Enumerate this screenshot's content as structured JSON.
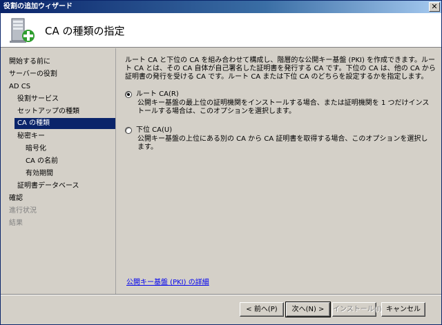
{
  "window": {
    "title": "役割の追加ウィザード",
    "close_glyph": "✕"
  },
  "header": {
    "title": "CA の種類の指定",
    "icon": "server-add-icon"
  },
  "sidebar": {
    "items": [
      {
        "label": "開始する前に",
        "state": "normal"
      },
      {
        "label": "サーバーの役割",
        "state": "normal"
      },
      {
        "label": "AD CS",
        "state": "normal"
      },
      {
        "label": "役割サービス",
        "state": "normal"
      },
      {
        "label": "セットアップの種類",
        "state": "normal"
      },
      {
        "label": "CA の種類",
        "state": "selected"
      },
      {
        "label": "秘密キー",
        "state": "normal"
      },
      {
        "label": "暗号化",
        "state": "normal"
      },
      {
        "label": "CA の名前",
        "state": "normal"
      },
      {
        "label": "有効期間",
        "state": "normal"
      },
      {
        "label": "証明書データベース",
        "state": "normal"
      },
      {
        "label": "確認",
        "state": "normal"
      },
      {
        "label": "進行状況",
        "state": "disabled"
      },
      {
        "label": "結果",
        "state": "disabled"
      }
    ]
  },
  "content": {
    "intro": "ルート CA と下位の CA を組み合わせて構成し、階層的な公開キー基盤 (PKI) を作成できます。ルート CA とは、その CA 自体が自己署名した証明書を発行する CA です。下位の CA は、他の CA から証明書の発行を受ける CA です。ルート CA または下位 CA のどちらを設定するかを指定します。",
    "options": [
      {
        "label": "ルート CA(R)",
        "checked": true,
        "description": "公開キー基盤の最上位の証明機関をインストールする場合、または証明機関を 1 つだけインストールする場合は、このオプションを選択します。"
      },
      {
        "label": "下位 CA(U)",
        "checked": false,
        "description": "公開キー基盤の上位にある別の CA から CA 証明書を取得する場合、このオプションを選択します。"
      }
    ],
    "link": "公開キー基盤 (PKI) の詳細"
  },
  "buttons": {
    "back": "< 前へ(P)",
    "next": "次へ(N) >",
    "install": "インストール(I)",
    "cancel": "キャンセル"
  },
  "colors": {
    "titlebar": "#0a246a",
    "selected": "#0a246a",
    "link": "#0000ee",
    "chrome": "#d4d0c8"
  }
}
